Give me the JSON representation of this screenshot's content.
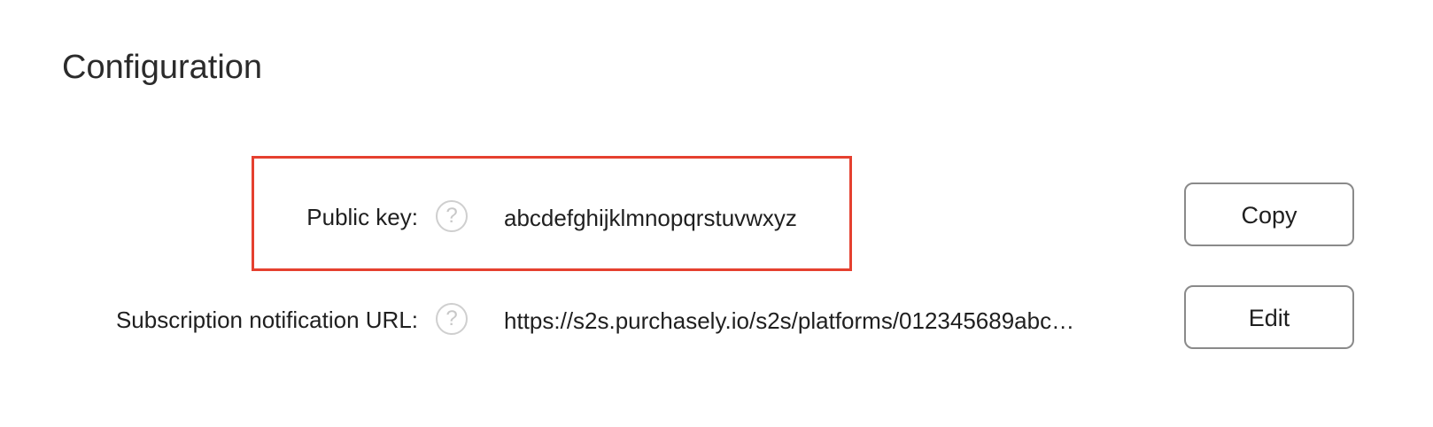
{
  "page": {
    "title": "Configuration"
  },
  "rows": [
    {
      "label": "Public key:",
      "help_icon": "help-icon",
      "value": "abcdefghijklmnopqrstuvwxyz",
      "highlighted": true,
      "highlight_color": "#e5402f",
      "button_label": "Copy"
    },
    {
      "label": "Subscription notification URL:",
      "help_icon": "help-icon",
      "value": "https://s2s.purchasely.io/s2s/platforms/012345689abc…",
      "highlighted": false,
      "button_label": "Edit"
    }
  ],
  "icons": {
    "help_glyph": "?"
  }
}
